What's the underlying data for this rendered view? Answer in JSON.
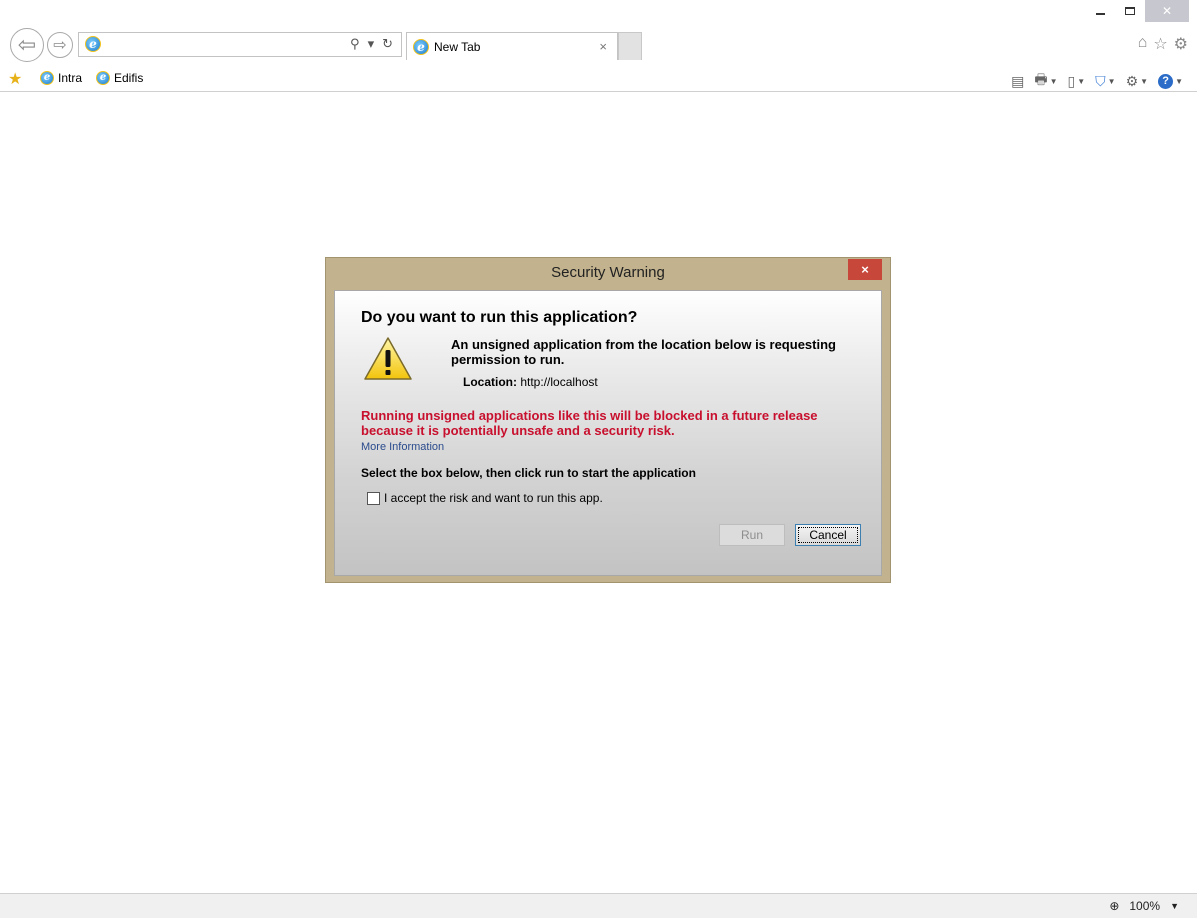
{
  "browser": {
    "address_value": "",
    "tab_title": "New Tab",
    "tab_close": "×",
    "search_glyph": "⚲",
    "dropdown_glyph": "▾",
    "refresh_glyph": "↻",
    "back_glyph": "⇦",
    "forward_glyph": "⇨"
  },
  "favorites": {
    "items": [
      {
        "label": "Intra"
      },
      {
        "label": "Edifis"
      }
    ]
  },
  "status_bar": {
    "zoom_label": "100%"
  },
  "dialog": {
    "title": "Security Warning",
    "close_label": "×",
    "heading": "Do you want to run this application?",
    "description": "An unsigned application from the location below is requesting permission to run.",
    "location_label": "Location:",
    "location_value": "http://localhost",
    "red_warning": "Running unsigned applications like this will be blocked in a future release because it is potentially unsafe and a security risk.",
    "more_info": "More Information",
    "instruction": "Select the box below, then click run to start the application",
    "accept_label": "I accept the risk and want to run this app.",
    "accept_checked": false,
    "run_label": "Run",
    "cancel_label": "Cancel"
  },
  "colors": {
    "dialog_frame": "#c2b38e",
    "close_button": "#c7473b",
    "warning_text": "#c8102e",
    "link_text": "#2a4b8d"
  }
}
